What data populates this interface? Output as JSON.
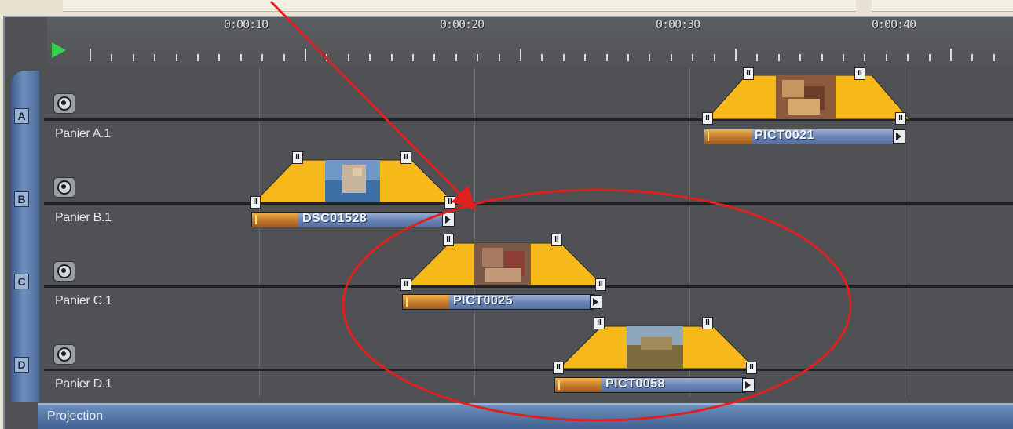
{
  "ruler": {
    "timecodes": [
      "0:00:10",
      "0:00:20",
      "0:00:30",
      "0:00:40"
    ]
  },
  "tracks": [
    {
      "letter": "A",
      "name": "Panier A.1"
    },
    {
      "letter": "B",
      "name": "Panier B.1"
    },
    {
      "letter": "C",
      "name": "Panier C.1"
    },
    {
      "letter": "D",
      "name": "Panier D.1"
    }
  ],
  "clips": [
    {
      "track": "A",
      "name": "PICT0021"
    },
    {
      "track": "B",
      "name": "DSC01528"
    },
    {
      "track": "C",
      "name": "PICT0025"
    },
    {
      "track": "D",
      "name": "PICT0058"
    }
  ],
  "status": {
    "label": "Projection"
  },
  "colors": {
    "annotation": "#e0201c",
    "fade": "#f7b81a",
    "clip_bar": "#6883b4",
    "clip_progress": "#c1752b",
    "background": "#4f5154"
  }
}
